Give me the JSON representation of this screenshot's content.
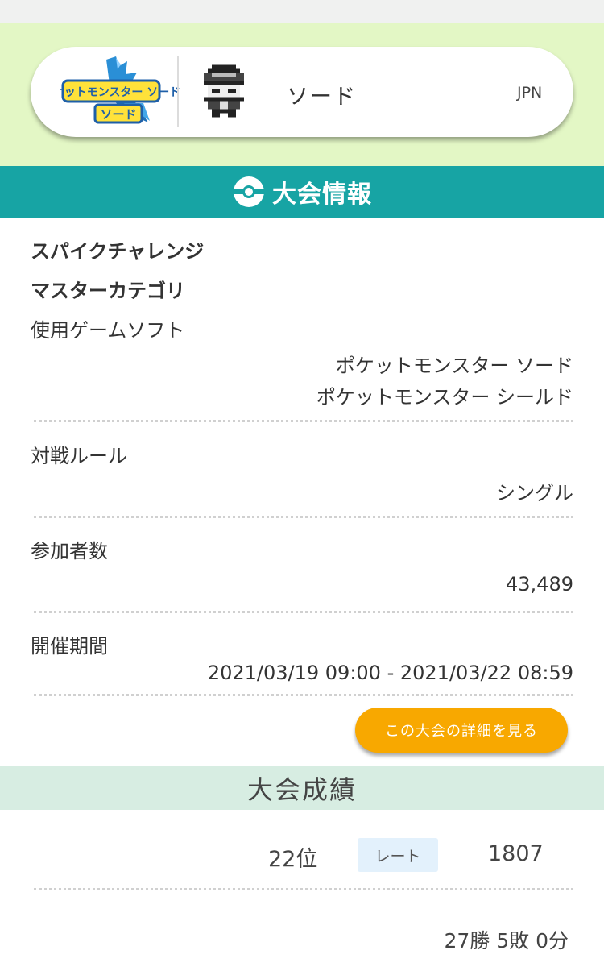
{
  "profile": {
    "game_logo_text": "ポケットモンスター ソード",
    "name": "ソード",
    "region": "JPN"
  },
  "section": {
    "icon": "pokeball-icon",
    "title": "大会情報"
  },
  "tournament": {
    "name": "スパイクチャレンジ",
    "category": "マスターカテゴリ",
    "software_label": "使用ゲームソフト",
    "software_values": [
      "ポケットモンスター ソード",
      "ポケットモンスター シールド"
    ],
    "rule_label": "対戦ルール",
    "rule_value": "シングル",
    "participants_label": "参加者数",
    "participants_value": "43,489",
    "period_label": "開催期間",
    "period_value": "2021/03/19 09:00 - 2021/03/22 08:59",
    "detail_button": "この大会の詳細を見る"
  },
  "results": {
    "title": "大会成績",
    "rank": "22位",
    "rate_label": "レート",
    "rate_value": "1807",
    "record": "27勝 5敗 0分"
  },
  "colors": {
    "teal": "#17a4a4",
    "hero_bg": "#e3f7c5",
    "button_orange": "#f8a800",
    "results_bg": "#d7ede2",
    "rate_badge_bg": "#e3f1fc"
  }
}
